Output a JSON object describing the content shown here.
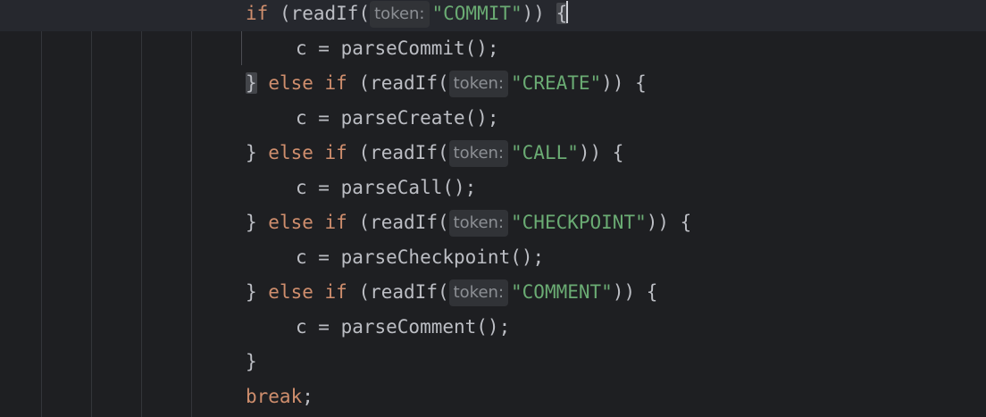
{
  "code_lines": [
    {
      "indent": 0,
      "tokens": [
        {
          "k": "kw",
          "t": "if"
        },
        {
          "k": "p",
          "t": " (readIf("
        },
        {
          "k": "hint",
          "t": "token:"
        },
        {
          "k": "str",
          "t": "\"COMMIT\""
        },
        {
          "k": "p",
          "t": ")) "
        },
        {
          "k": "brace-hl",
          "t": "{"
        },
        {
          "k": "caret",
          "t": ""
        }
      ]
    },
    {
      "indent": 1,
      "tokens": [
        {
          "k": "p",
          "t": "c = parseCommit();"
        }
      ]
    },
    {
      "indent": 0,
      "tokens": [
        {
          "k": "brace-hl",
          "t": "}"
        },
        {
          "k": "p",
          "t": " "
        },
        {
          "k": "kw",
          "t": "else if"
        },
        {
          "k": "p",
          "t": " (readIf("
        },
        {
          "k": "hint",
          "t": "token:"
        },
        {
          "k": "str",
          "t": "\"CREATE\""
        },
        {
          "k": "p",
          "t": ")) {"
        }
      ]
    },
    {
      "indent": 1,
      "tokens": [
        {
          "k": "p",
          "t": "c = parseCreate();"
        }
      ]
    },
    {
      "indent": 0,
      "tokens": [
        {
          "k": "p",
          "t": "} "
        },
        {
          "k": "kw",
          "t": "else if"
        },
        {
          "k": "p",
          "t": " (readIf("
        },
        {
          "k": "hint",
          "t": "token:"
        },
        {
          "k": "str",
          "t": "\"CALL\""
        },
        {
          "k": "p",
          "t": ")) {"
        }
      ]
    },
    {
      "indent": 1,
      "tokens": [
        {
          "k": "p",
          "t": "c = parseCall();"
        }
      ]
    },
    {
      "indent": 0,
      "tokens": [
        {
          "k": "p",
          "t": "} "
        },
        {
          "k": "kw",
          "t": "else if"
        },
        {
          "k": "p",
          "t": " (readIf("
        },
        {
          "k": "hint",
          "t": "token:"
        },
        {
          "k": "str",
          "t": "\"CHECKPOINT\""
        },
        {
          "k": "p",
          "t": ")) {"
        }
      ]
    },
    {
      "indent": 1,
      "tokens": [
        {
          "k": "p",
          "t": "c = parseCheckpoint();"
        }
      ]
    },
    {
      "indent": 0,
      "tokens": [
        {
          "k": "p",
          "t": "} "
        },
        {
          "k": "kw",
          "t": "else if"
        },
        {
          "k": "p",
          "t": " (readIf("
        },
        {
          "k": "hint",
          "t": "token:"
        },
        {
          "k": "str",
          "t": "\"COMMENT\""
        },
        {
          "k": "p",
          "t": ")) {"
        }
      ]
    },
    {
      "indent": 1,
      "tokens": [
        {
          "k": "p",
          "t": "c = parseComment();"
        }
      ]
    },
    {
      "indent": 0,
      "tokens": [
        {
          "k": "p",
          "t": "}"
        }
      ]
    },
    {
      "indent": 0,
      "tokens": [
        {
          "k": "kw",
          "t": "break"
        },
        {
          "k": "p",
          "t": ";"
        }
      ]
    }
  ],
  "current_line_index": 0,
  "colors": {
    "background": "#1e1f22",
    "keyword": "#cf8e6d",
    "string": "#6aab73",
    "plain": "#bcbec4",
    "inlay_hint": "#8c8f94"
  }
}
